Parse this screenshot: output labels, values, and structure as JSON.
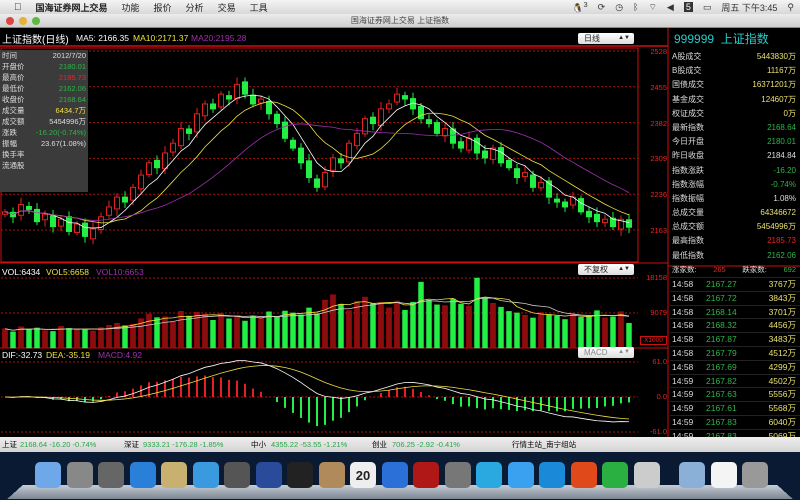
{
  "menubar": {
    "apple": "",
    "items": [
      "国海证券网上交易",
      "功能",
      "报价",
      "分析",
      "交易",
      "工具"
    ],
    "clock": "周五 下午3:45",
    "qq_badge": "3",
    "icons": [
      "qq-icon",
      "sync-icon",
      "time-machine-icon",
      "bluetooth-icon",
      "wifi-icon",
      "volume-icon",
      "input-method-icon",
      "battery-icon",
      "spotlight-icon"
    ]
  },
  "window": {
    "title": "国海证券网上交易 上证指数"
  },
  "main": {
    "title": "上证指数(日线)",
    "ma5": "MA5: 2166.35",
    "ma10": "MA10:2171.37",
    "ma20": "MA20:2195.28",
    "period_select": "日线",
    "price_axis": [
      "2528",
      "2455",
      "2382",
      "2309",
      "2236",
      "2163"
    ]
  },
  "info": [
    {
      "k": "时间",
      "v": "2012/7/20",
      "c": "#ddd"
    },
    {
      "k": "开盘价",
      "v": "2180.01",
      "c": "#2fb34a"
    },
    {
      "k": "最高价",
      "v": "2185.73",
      "c": "#e22"
    },
    {
      "k": "最低价",
      "v": "2162.06",
      "c": "#2fb34a"
    },
    {
      "k": "收盘价",
      "v": "2168.64",
      "c": "#2fb34a"
    },
    {
      "k": "成交量",
      "v": "6434.7万",
      "c": "#f0e040"
    },
    {
      "k": "成交额",
      "v": "5454996万",
      "c": "#ddd"
    },
    {
      "k": "涨跌",
      "v": "-16.20(-0.74%)",
      "c": "#2fb34a"
    },
    {
      "k": "振幅",
      "v": "23.67(1.08%)",
      "c": "#ddd"
    },
    {
      "k": "换手率",
      "v": "",
      "c": "#ddd"
    },
    {
      "k": "流通股",
      "v": "",
      "c": "#ddd"
    }
  ],
  "vol": {
    "vol": "VOL:6434",
    "vol5": "VOL5:6658",
    "vol10": "VOL10:6653",
    "select": "不复权",
    "axis": [
      "18158",
      "9079"
    ],
    "unit": "X1000"
  },
  "macd": {
    "dif": "DIF:-32.73",
    "dea": "DEA:-35.19",
    "macd": "MACD:4.92",
    "select": "MACD",
    "axis": [
      "61.0",
      "0.0",
      "-61.0"
    ]
  },
  "right": {
    "code": "999999",
    "name": "上证指数",
    "rows": [
      {
        "k": "A股成交",
        "v": "5443830万",
        "c": "#e8e070"
      },
      {
        "k": "B股成交",
        "v": "11167万",
        "c": "#e8e070"
      },
      {
        "k": "国债成交",
        "v": "16371201万",
        "c": "#e8e070"
      },
      {
        "k": "基金成交",
        "v": "124607万",
        "c": "#e8e070"
      },
      {
        "k": "权证成交",
        "v": "0万",
        "c": "#e8e070"
      },
      {
        "k": "最新指数",
        "v": "2168.64",
        "c": "#2fb34a"
      },
      {
        "k": "今日开盘",
        "v": "2180.01",
        "c": "#2fb34a"
      },
      {
        "k": "昨日收盘",
        "v": "2184.84",
        "c": "#ddd"
      },
      {
        "k": "指数涨跌",
        "v": "-16.20",
        "c": "#2fb34a"
      },
      {
        "k": "指数涨幅",
        "v": "-0.74%",
        "c": "#2fb34a"
      },
      {
        "k": "指数振幅",
        "v": "1.08%",
        "c": "#ddd"
      },
      {
        "k": "总成交量",
        "v": "64346672",
        "c": "#e8e070"
      },
      {
        "k": "总成交额",
        "v": "5454996万",
        "c": "#e8e070"
      },
      {
        "k": "最高指数",
        "v": "2185.73",
        "c": "#e22"
      },
      {
        "k": "最低指数",
        "v": "2162.06",
        "c": "#2fb34a"
      }
    ],
    "up_label": "涨家数:",
    "up": "265",
    "down_label": "跌家数:",
    "down": "692",
    "ticks": [
      [
        "14:58",
        "2167.27",
        "3767万"
      ],
      [
        "14:58",
        "2167.72",
        "3843万"
      ],
      [
        "14:58",
        "2168.14",
        "3701万"
      ],
      [
        "14:58",
        "2168.32",
        "4456万"
      ],
      [
        "14:58",
        "2167.87",
        "3483万"
      ],
      [
        "14:58",
        "2167.79",
        "4512万"
      ],
      [
        "14:58",
        "2167.69",
        "4299万"
      ],
      [
        "14:59",
        "2167.82",
        "4502万"
      ],
      [
        "14:59",
        "2167.63",
        "5556万"
      ],
      [
        "14:59",
        "2167.61",
        "5568万"
      ],
      [
        "14:59",
        "2167.83",
        "6040万"
      ],
      [
        "14:59",
        "2167.83",
        "5069万"
      ]
    ]
  },
  "bottom": {
    "sh_label": "上证",
    "sh": "2168.64  -16.20  -0.74%",
    "sz_label": "深证",
    "sz": "9333.21  -176.28  -1.85%",
    "zx_label": "中小",
    "zx": "4355.22  -53.55  -1.21%",
    "cy_label": "创业",
    "cy": "706.25  -2.92  -0.41%",
    "server": "行情主站_南宁组站"
  },
  "dock": {
    "icons": [
      "finder-icon",
      "launchpad-icon",
      "dashboard-icon",
      "app-store-icon",
      "mail-icon",
      "safari-icon",
      "facetime-icon",
      "stock-app-icon",
      "qq-icon",
      "contacts-icon",
      "calendar-icon",
      "itunes-icon",
      "photo-booth-icon",
      "system-preferences-icon",
      "messenger-icon",
      "messages-icon",
      "word-icon",
      "powerpoint-icon",
      "excel-icon",
      "preview-icon",
      "documents-folder-icon",
      "file-icon",
      "trash-icon"
    ],
    "calendar_day": "20"
  },
  "colors": {
    "up": "#e22222",
    "down": "#22ee44",
    "ma5": "#ffffff",
    "ma10": "#f0e040",
    "ma20": "#a030b0",
    "axis": "#cc1111"
  },
  "chart_data": {
    "type": "candlestick",
    "title": "上证指数(日线)",
    "ylim": [
      2140,
      2535
    ],
    "closes": [
      2200,
      2190,
      2215,
      2205,
      2180,
      2195,
      2170,
      2185,
      2160,
      2175,
      2150,
      2165,
      2190,
      2210,
      2230,
      2220,
      2250,
      2275,
      2300,
      2290,
      2320,
      2340,
      2370,
      2360,
      2400,
      2420,
      2410,
      2440,
      2430,
      2460,
      2440,
      2420,
      2430,
      2400,
      2380,
      2350,
      2330,
      2300,
      2270,
      2250,
      2280,
      2310,
      2300,
      2340,
      2360,
      2390,
      2380,
      2410,
      2420,
      2440,
      2430,
      2410,
      2390,
      2380,
      2360,
      2370,
      2340,
      2330,
      2350,
      2320,
      2310,
      2330,
      2300,
      2290,
      2270,
      2280,
      2250,
      2260,
      2230,
      2220,
      2210,
      2230,
      2200,
      2190,
      2180,
      2185,
      2170,
      2184.84,
      2168.64
    ],
    "volumes": [
      5000,
      4200,
      5500,
      4800,
      5200,
      4500,
      4300,
      5600,
      5100,
      4900,
      4700,
      4400,
      5300,
      5900,
      6400,
      5800,
      6200,
      7600,
      8800,
      7900,
      8100,
      6700,
      9500,
      8300,
      9300,
      8800,
      7200,
      9000,
      7600,
      8400,
      7000,
      8200,
      7800,
      9400,
      8100,
      9600,
      9100,
      8600,
      10400,
      8900,
      12400,
      13800,
      11300,
      9700,
      12100,
      13200,
      11600,
      11800,
      10400,
      12200,
      9800,
      11900,
      17100,
      12400,
      11200,
      11000,
      12700,
      11400,
      10900,
      18158,
      12900,
      11600,
      10600,
      9500,
      9100,
      8500,
      7800,
      9200,
      8700,
      8300,
      7400,
      8900,
      8000,
      8200,
      9700,
      7800,
      8100,
      9400,
      6434
    ]
  }
}
